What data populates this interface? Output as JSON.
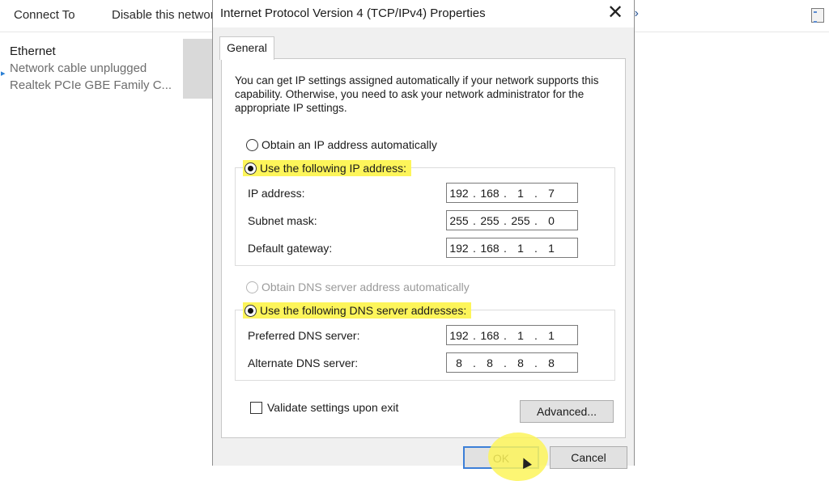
{
  "background": {
    "toolbar": {
      "connect_to": "Connect To",
      "disable": "Disable this network device",
      "more": "»"
    },
    "adapter": {
      "name": "Ethernet",
      "status": "Network cable unplugged",
      "device": "Realtek PCIe GBE Family C..."
    }
  },
  "dialog": {
    "title": "Internet Protocol Version 4 (TCP/IPv4) Properties",
    "close": "✕",
    "tab": "General",
    "intro": "You can get IP settings assigned automatically if your network supports this capability. Otherwise, you need to ask your network administrator for the appropriate IP settings.",
    "ip": {
      "auto_label": "Obtain an IP address automatically",
      "manual_label": "Use the following IP address:",
      "fields": [
        {
          "label": "IP address:",
          "octets": [
            "192",
            "168",
            "1",
            "7"
          ]
        },
        {
          "label": "Subnet mask:",
          "octets": [
            "255",
            "255",
            "255",
            "0"
          ]
        },
        {
          "label": "Default gateway:",
          "octets": [
            "192",
            "168",
            "1",
            "1"
          ]
        }
      ]
    },
    "dns": {
      "auto_label": "Obtain DNS server address automatically",
      "manual_label": "Use the following DNS server addresses:",
      "fields": [
        {
          "label": "Preferred DNS server:",
          "octets": [
            "192",
            "168",
            "1",
            "1"
          ]
        },
        {
          "label": "Alternate DNS server:",
          "octets": [
            "8",
            "8",
            "8",
            "8"
          ]
        }
      ]
    },
    "validate_label": "Validate settings upon exit",
    "advanced": "Advanced...",
    "ok": "OK",
    "cancel": "Cancel"
  },
  "colors": {
    "highlight": "#fdf55a",
    "focus": "#3c7fd8"
  }
}
